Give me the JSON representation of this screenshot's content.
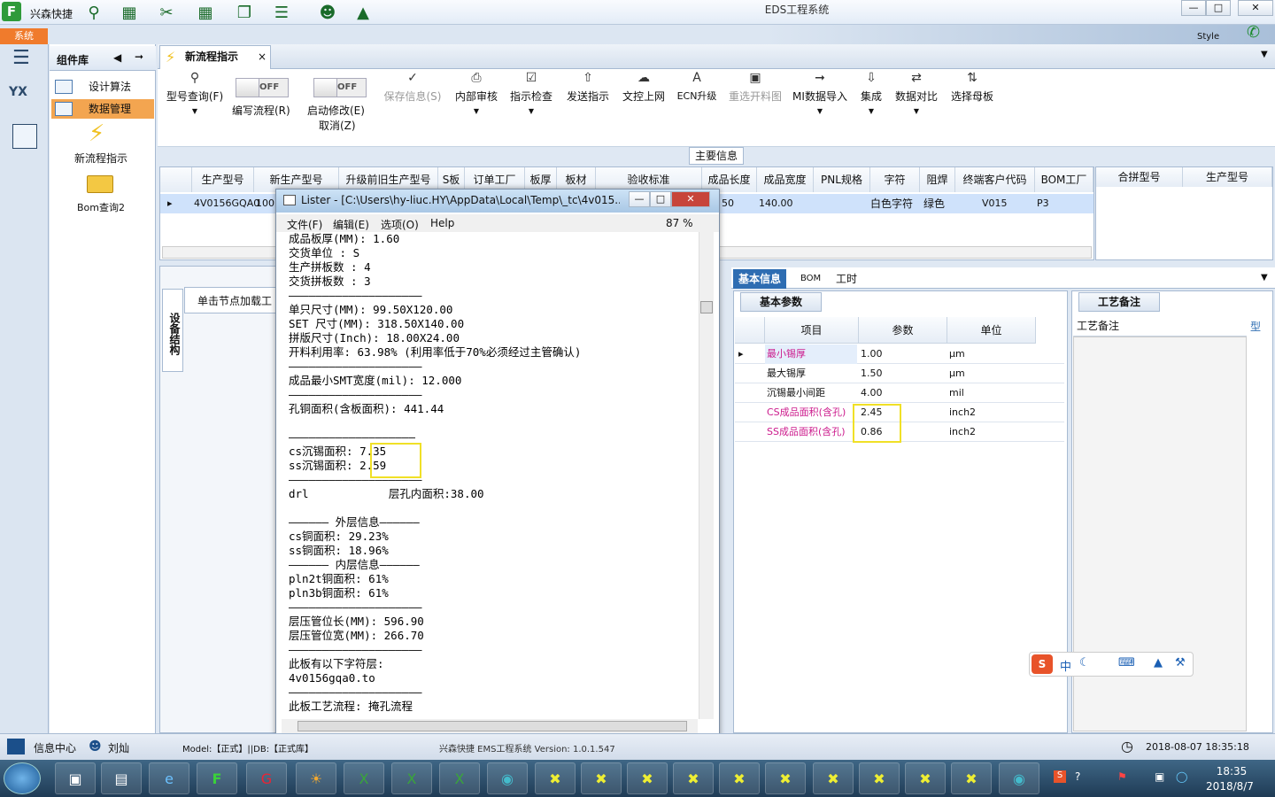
{
  "app": {
    "name": "兴森快捷",
    "window_title": "EDS工程系统",
    "system_tab": "系统",
    "style_label": "Style",
    "colors": {
      "accent": "#2e6db2",
      "highlight": "#f0e027",
      "pink": "#cc1a8c",
      "system_tab": "#f07b2c"
    }
  },
  "components": {
    "title": "组件库",
    "items": [
      "设计算法",
      "数据管理",
      "新流程指示",
      "Bom查询2"
    ]
  },
  "doc_tab": {
    "label": "新流程指示"
  },
  "toolbar": {
    "query": "型号查询(F)",
    "toggle1": {
      "state": "OFF",
      "label": "编写流程(R)"
    },
    "toggle2": {
      "state": "OFF",
      "label": "启动修改(E)",
      "sub": "取消(Z)"
    },
    "buttons": [
      "保存信息(S)",
      "内部审核",
      "指示检查",
      "发送指示",
      "文控上网",
      "ECN升级",
      "重选开料图",
      "MI数据导入",
      "集成",
      "数据对比",
      "选择母板"
    ]
  },
  "main_info": "主要信息",
  "grid1": {
    "headers": [
      "生产型号",
      "新生产型号",
      "升级前旧生产型号",
      "S板",
      "订单工厂",
      "板厚",
      "板材",
      "验收标准",
      "成品长度",
      "成品宽度",
      "PNL规格",
      "字符",
      "阻焊",
      "终端客户代码",
      "BOM工厂"
    ],
    "row": [
      "4V0156GQA0",
      "1001",
      "",
      "",
      "",
      "",
      "",
      "",
      "50",
      "140.00",
      "",
      "白色字符",
      "绿色",
      "V015",
      "P3"
    ]
  },
  "grid2": {
    "headers": [
      "合拼型号",
      "生产型号"
    ]
  },
  "left_lower": {
    "vertical_tab": "设备结构",
    "hint": "单击节点加载工"
  },
  "right_tabs": [
    "基本信息",
    "BOM",
    "工时"
  ],
  "base_params": {
    "tab": "基本参数",
    "headers": [
      "项目",
      "参数",
      "单位"
    ],
    "rows": [
      {
        "item": "最小锡厚",
        "value": "1.00",
        "unit": "μm"
      },
      {
        "item": "最大锡厚",
        "value": "1.50",
        "unit": "μm"
      },
      {
        "item": "沉锡最小间距",
        "value": "4.00",
        "unit": "mil"
      },
      {
        "item": "CS成品面积(含孔)",
        "value": "2.45",
        "unit": "inch2"
      },
      {
        "item": "SS成品面积(含孔)",
        "value": "0.86",
        "unit": "inch2"
      }
    ]
  },
  "craft": {
    "tab": "工艺备注",
    "header": "工艺备注",
    "col2": "型"
  },
  "lister": {
    "title": "Lister - [C:\\Users\\hy-liuc.HY\\AppData\\Local\\Temp\\_tc\\4v015...",
    "menu": [
      "文件(F)",
      "编辑(E)",
      "选项(O)",
      "Help"
    ],
    "zoom": "87 %",
    "lines": [
      "成品板厚(MM): 1.60",
      "交货单位 : S",
      "生产拼板数 : 4",
      "交货拼板数 : 3",
      "————————————————————",
      "单只尺寸(MM): 99.50X120.00",
      "SET 尺寸(MM): 318.50X140.00",
      "拼版尺寸(Inch): 18.00X24.00",
      "开料利用率: 63.98% (利用率低于70%必须经过主管确认)",
      "————————————————————",
      "成品最小SMT宽度(mil): 12.000",
      "————————————————————",
      "孔铜面积(含板面积): 441.44",
      "",
      "———————————————————",
      "cs沉锡面积: 7.35",
      "ss沉锡面积: 2.59",
      "————————————————————",
      "drl            层孔内面积:38.00",
      "",
      "—————— 外层信息——————",
      "cs铜面积: 29.23%",
      "ss铜面积: 18.96%",
      "—————— 内层信息——————",
      "pln2t铜面积: 61%",
      "pln3b铜面积: 61%",
      "————————————————————",
      "层压管位长(MM): 596.90",
      "层压管位宽(MM): 266.70",
      "————————————————————",
      "此板有以下字符层:",
      "4v0156gqa0.to",
      "————————————————————",
      "此板工艺流程: 掩孔流程"
    ]
  },
  "status": {
    "info_center": "信息中心",
    "user": "刘灿",
    "model": "Model:【正式】||DB:【正式库】",
    "version": "兴森快捷 EMS工程系统 Version: 1.0.1.547",
    "datetime": "2018-08-07 18:35:18"
  },
  "taskbar": {
    "time": "18:35",
    "date": "2018/8/7"
  }
}
